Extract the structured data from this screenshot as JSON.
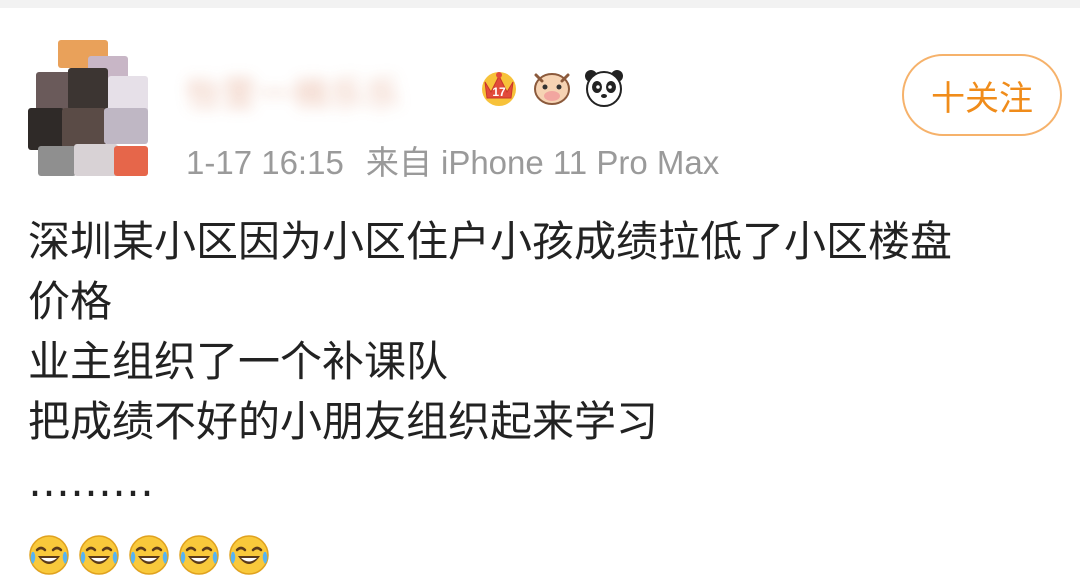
{
  "post": {
    "username": "怡萱一楠乐乐",
    "meta": {
      "time": "1-17 16:15",
      "source": "来自 iPhone 11 Pro Max"
    },
    "follow_label": "十关注",
    "lines": [
      "深圳某小区因为小区住户小孩成绩拉低了小区楼盘",
      "价格",
      "业主组织了一个补课队",
      "把成绩不好的小朋友组织起来学习",
      "………"
    ],
    "badges": [
      "crown-icon",
      "cow-icon",
      "panda-icon"
    ],
    "emoji_count": 5,
    "emoji_name": "laugh-cry-emoji"
  },
  "colors": {
    "follow_accent": "#f08c1a",
    "meta_gray": "#9a9a9a",
    "text": "#222222"
  }
}
